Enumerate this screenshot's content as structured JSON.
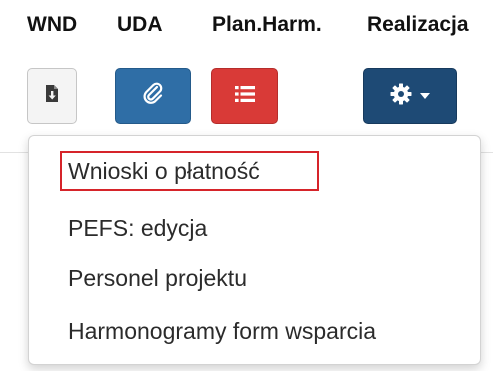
{
  "header": {
    "columns": [
      "WND",
      "UDA",
      "Plan.Harm.",
      "Realizacja"
    ]
  },
  "toolbar": {
    "buttons": [
      {
        "icon": "download-document-icon",
        "color": "#f4f4f4"
      },
      {
        "icon": "paperclip-icon",
        "color": "#2f6ea6"
      },
      {
        "icon": "list-icon",
        "color": "#d93a37"
      },
      {
        "icon": "gear-icon",
        "color": "#1e4a75",
        "has_caret": true
      }
    ]
  },
  "dropdown": {
    "items": [
      {
        "label": "Wnioski o płatność",
        "highlighted": true
      },
      {
        "label": "PEFS: edycja"
      },
      {
        "label": "Personel projektu"
      },
      {
        "label": "Harmonogramy form wsparcia"
      }
    ],
    "highlight_color": "#d6242a"
  }
}
